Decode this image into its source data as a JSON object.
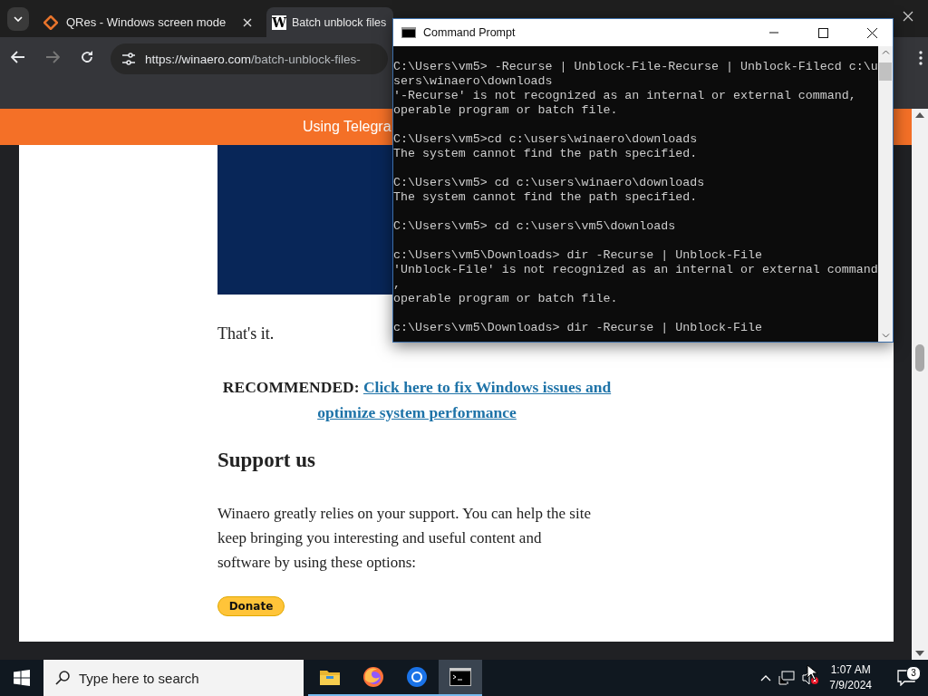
{
  "browser": {
    "tabs": [
      {
        "title": "QRes - Windows screen mode",
        "kind": "diamond",
        "selected": false
      },
      {
        "title": "Batch unblock files",
        "kind": "letter",
        "favicon_text": "W",
        "selected": true
      }
    ],
    "url": {
      "domain": "https://winaero.com",
      "path": "/batch-unblock-files-"
    },
    "banner": "Using Telegra",
    "article": {
      "closing": "That's it.",
      "recommended": {
        "label": "RECOMMENDED:",
        "link": "Click here to fix Windows issues and optimize system performance"
      },
      "heading": "Support us",
      "paragraph": "Winaero greatly relies on your support. You can help the site keep bringing you interesting and useful content and software by using these options:",
      "donate": "Donate"
    }
  },
  "console": {
    "title": "Command Prompt",
    "blocks": [
      [
        "C:\\Users\\vm5> -Recurse | Unblock-File-Recurse | Unblock-Filecd c:\\u",
        "sers\\winaero\\downloads",
        "'-Recurse' is not recognized as an internal or external command,",
        "operable program or batch file."
      ],
      [
        "C:\\Users\\vm5>cd c:\\users\\winaero\\downloads",
        "The system cannot find the path specified."
      ],
      [
        "C:\\Users\\vm5> cd c:\\users\\winaero\\downloads",
        "The system cannot find the path specified."
      ],
      [
        "C:\\Users\\vm5> cd c:\\users\\vm5\\downloads"
      ],
      [
        "c:\\Users\\vm5\\Downloads> dir -Recurse | Unblock-File",
        "'Unblock-File' is not recognized as an internal or external command",
        ",",
        "operable program or batch file."
      ],
      [
        "c:\\Users\\vm5\\Downloads> dir -Recurse | Unblock-File"
      ]
    ]
  },
  "taskbar": {
    "search_placeholder": "Type here to search",
    "apps": [
      {
        "kind": "folder",
        "selected": false
      },
      {
        "kind": "firefox",
        "selected": false
      },
      {
        "kind": "chrome",
        "selected": false
      },
      {
        "kind": "terminal",
        "selected": true
      }
    ],
    "time": "1:07 AM",
    "date": "7/9/2024",
    "notifications": "3"
  }
}
